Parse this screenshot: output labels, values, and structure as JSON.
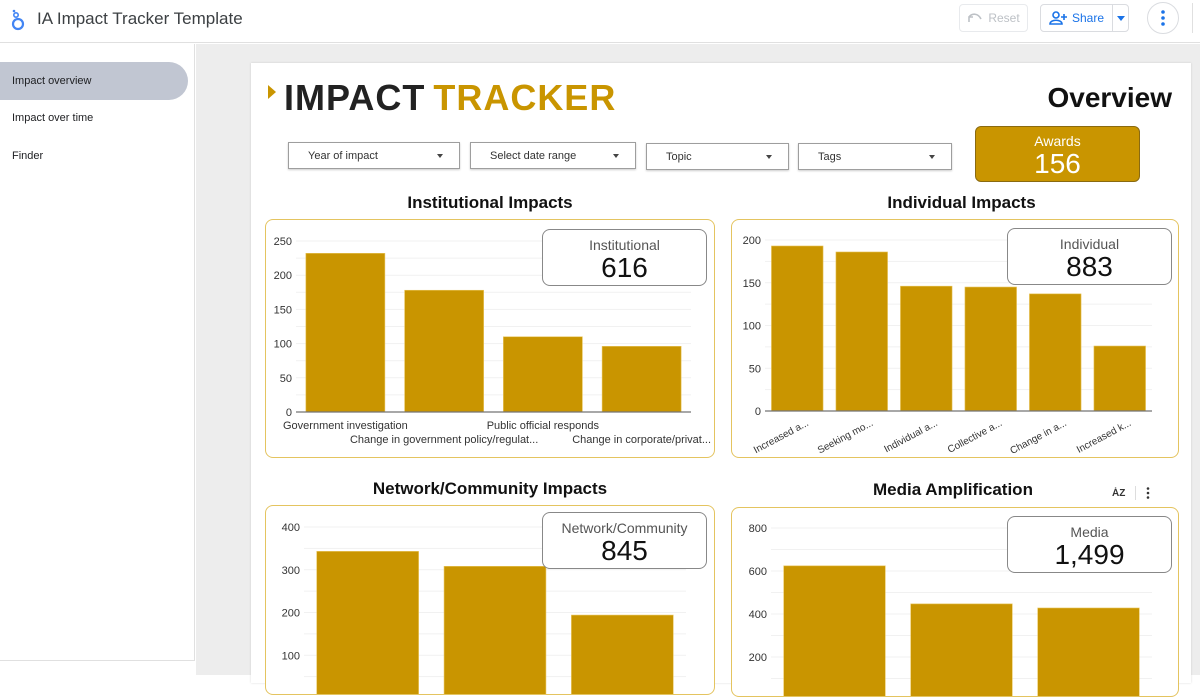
{
  "app": {
    "title": "IA Impact Tracker Template",
    "logo_icon": "looker-studio-icon",
    "reset_label": "Reset",
    "share_label": "Share"
  },
  "sidebar": {
    "items": [
      {
        "label": "Impact overview",
        "active": true
      },
      {
        "label": "Impact over time",
        "active": false
      },
      {
        "label": "Finder",
        "active": false
      }
    ]
  },
  "report": {
    "logo_part1": "IMPACT",
    "logo_part2": "TRACKER",
    "page_title": "Overview",
    "filters": [
      {
        "label": "Year of impact"
      },
      {
        "label": "Select date range"
      },
      {
        "label": "Topic"
      },
      {
        "label": "Tags"
      }
    ],
    "awards": {
      "label": "Awards",
      "value": "156"
    },
    "colors": {
      "accent": "#c99500",
      "border": "#e4c460",
      "axis": "#757575",
      "grid": "#f1f1f1"
    }
  },
  "chart_data": [
    {
      "id": "institutional",
      "type": "bar",
      "title": "Institutional Impacts",
      "scorecard": {
        "label": "Institutional",
        "value": "616"
      },
      "categories": [
        "Government investigation",
        "Change in government policy/regulat...",
        "Public official responds",
        "Change in corporate/privat..."
      ],
      "values": [
        232,
        178,
        110,
        96
      ],
      "yticks": [
        0,
        50,
        100,
        150,
        200,
        250
      ],
      "ylim": [
        0,
        250
      ],
      "label_style": "staggered",
      "xlabel": "",
      "ylabel": ""
    },
    {
      "id": "individual",
      "type": "bar",
      "title": "Individual Impacts",
      "scorecard": {
        "label": "Individual",
        "value": "883"
      },
      "categories": [
        "Increased a...",
        "Seeking mo...",
        "Individual a...",
        "Collective a...",
        "Change in a...",
        "Increased k..."
      ],
      "values": [
        193,
        186,
        146,
        145,
        137,
        76
      ],
      "yticks": [
        0,
        50,
        100,
        150,
        200
      ],
      "ylim": [
        0,
        200
      ],
      "label_style": "rotated",
      "xlabel": "",
      "ylabel": ""
    },
    {
      "id": "network",
      "type": "bar",
      "title": "Network/Community Impacts",
      "scorecard": {
        "label": "Network/Community",
        "value": "845"
      },
      "categories": [
        "",
        "",
        ""
      ],
      "values": [
        343,
        308,
        194
      ],
      "yticks": [
        100,
        200,
        300,
        400
      ],
      "ylim": [
        0,
        400
      ],
      "label_style": "none",
      "xlabel": "",
      "ylabel": ""
    },
    {
      "id": "media",
      "type": "bar",
      "title": "Media Amplification",
      "scorecard": {
        "label": "Media",
        "value": "1,499"
      },
      "categories": [
        "",
        "",
        ""
      ],
      "values": [
        624,
        447,
        428
      ],
      "yticks": [
        200,
        400,
        600,
        800
      ],
      "ylim": [
        0,
        800
      ],
      "label_style": "none",
      "xlabel": "",
      "ylabel": ""
    }
  ],
  "chart_tools": {
    "sort_icon": "sort-az-icon",
    "more_icon": "more-vert-icon"
  }
}
